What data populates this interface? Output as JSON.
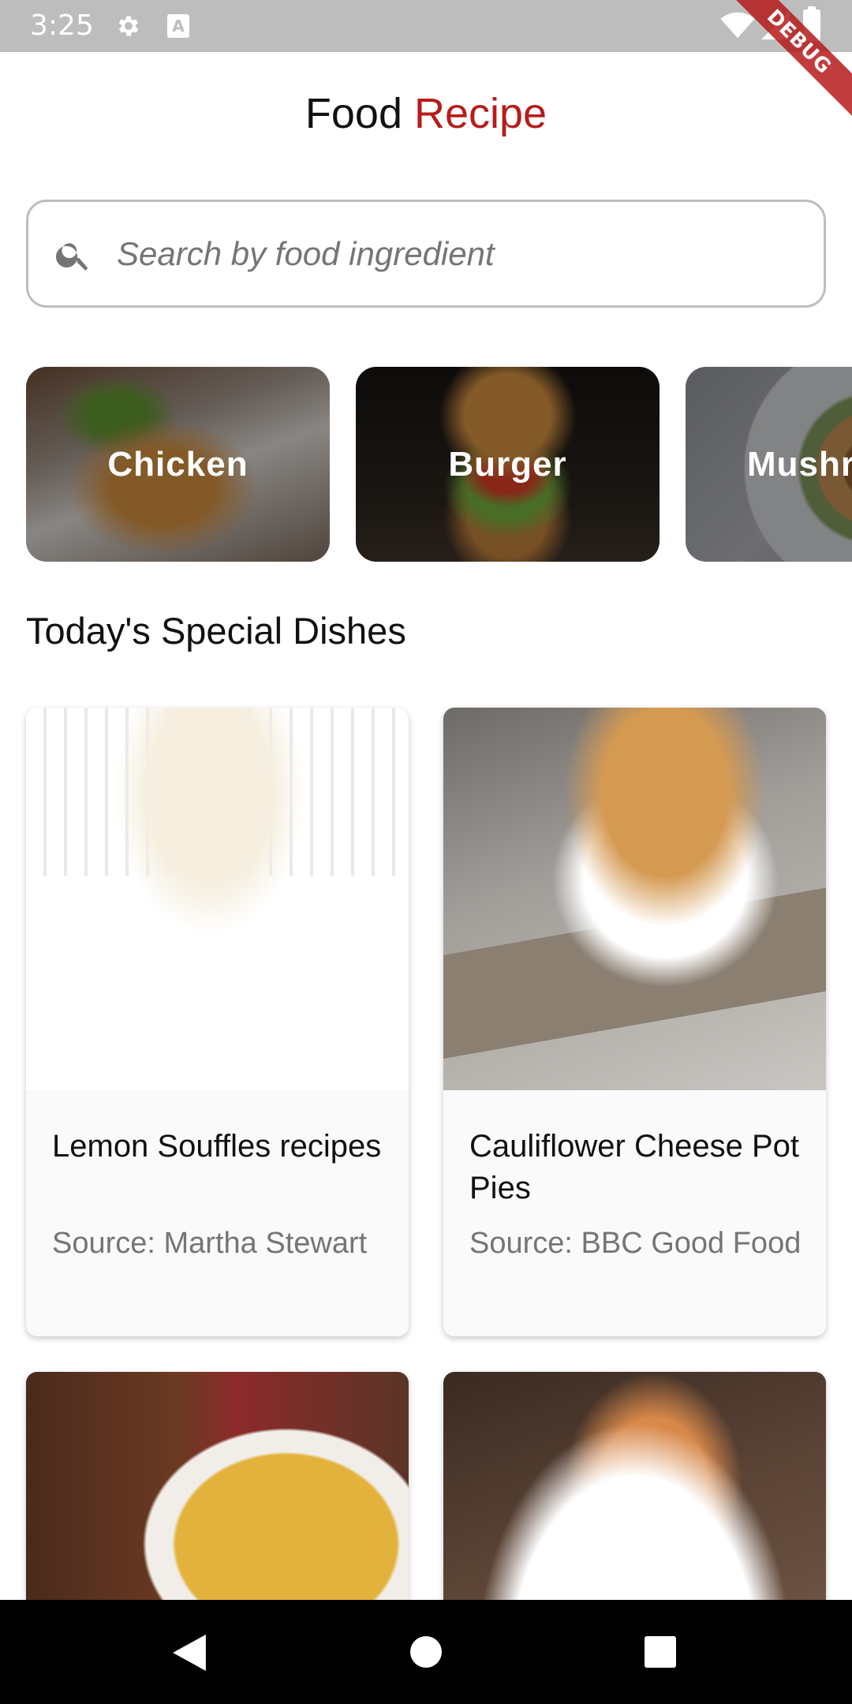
{
  "status_bar": {
    "time": "3:25",
    "icons": [
      "gear-icon",
      "text-a-icon",
      "wifi-icon",
      "signal-icon",
      "battery-icon"
    ],
    "a_icon_glyph": "A"
  },
  "debug_banner": {
    "label": "DEBUG"
  },
  "header": {
    "title_part1": "Food",
    "title_part2": "Recipe",
    "accent_color": "#b71c1c"
  },
  "search": {
    "placeholder": "Search by food ingredient",
    "value": "",
    "icon": "search-icon"
  },
  "categories": [
    {
      "label": "Chicken"
    },
    {
      "label": "Burger"
    },
    {
      "label": "Mushr"
    }
  ],
  "section": {
    "title": "Today's Special Dishes"
  },
  "dishes": [
    {
      "name": "Lemon Souffles recipes",
      "source": "Source: Martha Stewart"
    },
    {
      "name": "Cauliflower Cheese Pot Pies",
      "source": "Source: BBC Good Food"
    },
    {
      "name": "",
      "source": ""
    },
    {
      "name": "",
      "source": ""
    }
  ],
  "nav_bar": {
    "icons": [
      "back-icon",
      "home-icon",
      "recents-icon"
    ]
  }
}
